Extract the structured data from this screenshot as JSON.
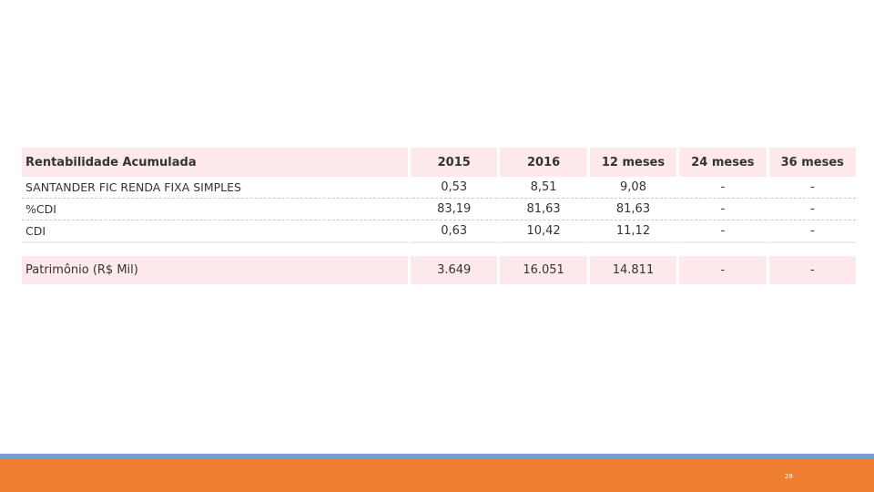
{
  "table": {
    "header": {
      "label": "Rentabilidade Acumulada",
      "columns": [
        "2015",
        "2016",
        "12 meses",
        "24 meses",
        "36 meses"
      ]
    },
    "rows": [
      {
        "label": "SANTANDER FIC RENDA FIXA SIMPLES",
        "values": [
          "0,53",
          "8,51",
          "9,08",
          "-",
          "-"
        ]
      },
      {
        "label": "%CDI",
        "values": [
          "83,19",
          "81,63",
          "81,63",
          "-",
          "-"
        ]
      },
      {
        "label": "CDI",
        "values": [
          "0,63",
          "10,42",
          "11,12",
          "-",
          "-"
        ]
      }
    ],
    "patrimonio": {
      "label": "Patrimônio (R$ Mil)",
      "values": [
        "3.649",
        "16.051",
        "14.811",
        "-",
        "-"
      ]
    }
  },
  "footer": {
    "page_number": "28",
    "line_color": "#6f9fd6",
    "bar_color": "#ef8032"
  },
  "colors": {
    "header_bg": "#fde9ec"
  }
}
